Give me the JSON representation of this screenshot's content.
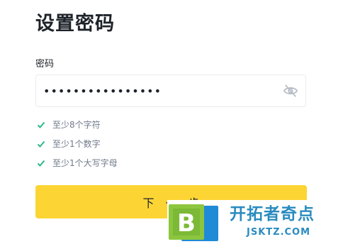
{
  "page": {
    "title": "设置密码"
  },
  "password_field": {
    "label": "密码",
    "value": "••••••••••••••••",
    "visibility_icon": "eye-slash-icon"
  },
  "rules": [
    {
      "text": "至少8个字符",
      "icon": "check-icon",
      "satisfied": true
    },
    {
      "text": "至少1个数字",
      "icon": "check-icon",
      "satisfied": true
    },
    {
      "text": "至少1个大写字母",
      "icon": "check-icon",
      "satisfied": true
    }
  ],
  "actions": {
    "next_label": "下一步"
  },
  "watermark": {
    "logo_letter": "B",
    "name": "开拓者奇点",
    "url": "JSKTZ.COM"
  },
  "colors": {
    "primary_button": "#fcd535",
    "check": "#2eb88a",
    "watermark": "#2a8bbf",
    "text": "#1e2329",
    "muted_text": "#707a8a"
  }
}
